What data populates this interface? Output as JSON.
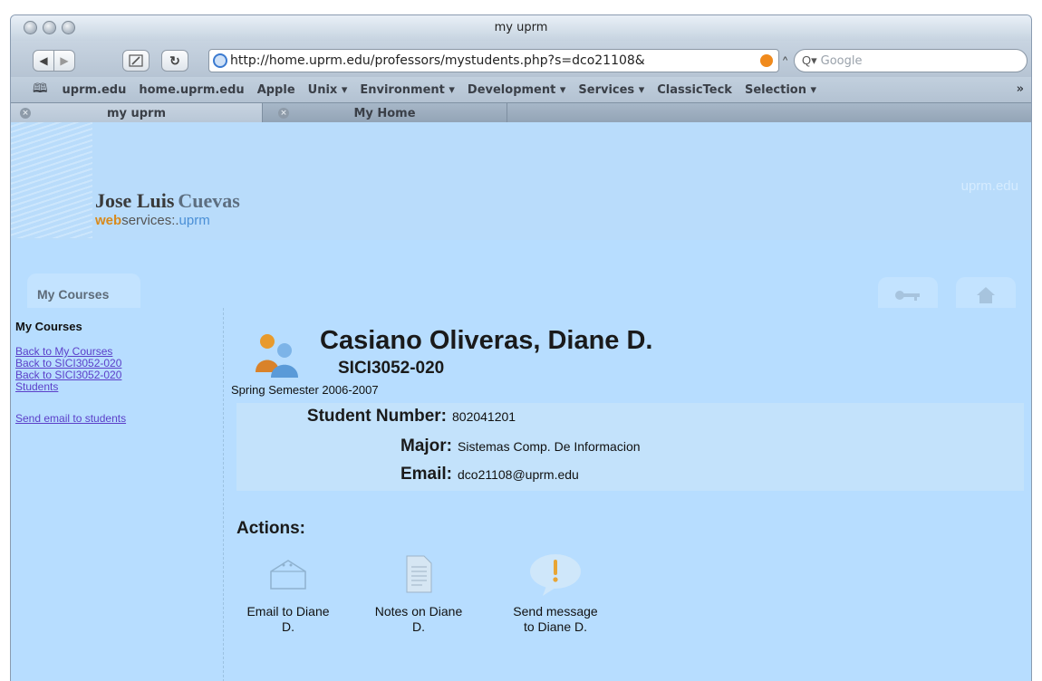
{
  "window": {
    "title": "my uprm"
  },
  "toolbar": {
    "url": "http://home.uprm.edu/professors/mystudents.php?s=dco21108&",
    "search_placeholder": "Google",
    "search_icon": "magnifier-icon",
    "reload_icon": "reload-icon"
  },
  "bookmarks": {
    "items": [
      "uprm.edu",
      "home.uprm.edu",
      "Apple",
      "Unix ▾",
      "Environment ▾",
      "Development ▾",
      "Services ▾",
      "ClassicTeck",
      "Selection ▾"
    ],
    "more": "»"
  },
  "tabs": [
    {
      "label": "my uprm",
      "active": true
    },
    {
      "label": "My Home",
      "active": false
    }
  ],
  "site": {
    "name_first": "Jose Luis",
    "name_last": "Cuevas",
    "sub_web": "web",
    "sub_services": "services:.",
    "sub_uprm": "uprm",
    "brand": "uprm.edu"
  },
  "nav": {
    "courses_tab": "My Courses"
  },
  "sidebar": {
    "title": "My Courses",
    "links": [
      "Back to My Courses",
      "Back to SICI3052-020",
      "Back to SICI3052-020",
      "Students"
    ],
    "email_link": "Send email to students"
  },
  "student": {
    "name": "Casiano Oliveras, Diane D.",
    "course": "SICI3052-020",
    "semester": "Spring Semester 2006-2007",
    "fields": [
      {
        "label": "Student Number:",
        "value": "802041201"
      },
      {
        "label": "Major:",
        "value": "Sistemas Comp. De Informacion"
      },
      {
        "label": "Email:",
        "value": "dco21108@uprm.edu"
      }
    ]
  },
  "actions": {
    "title": "Actions:",
    "items": [
      {
        "label": "Email to Diane D.",
        "icon": "mailbox-icon"
      },
      {
        "label": "Notes on Diane D.",
        "icon": "document-icon"
      },
      {
        "label": "Send message to Diane D.",
        "icon": "alert-bubble-icon"
      }
    ]
  }
}
